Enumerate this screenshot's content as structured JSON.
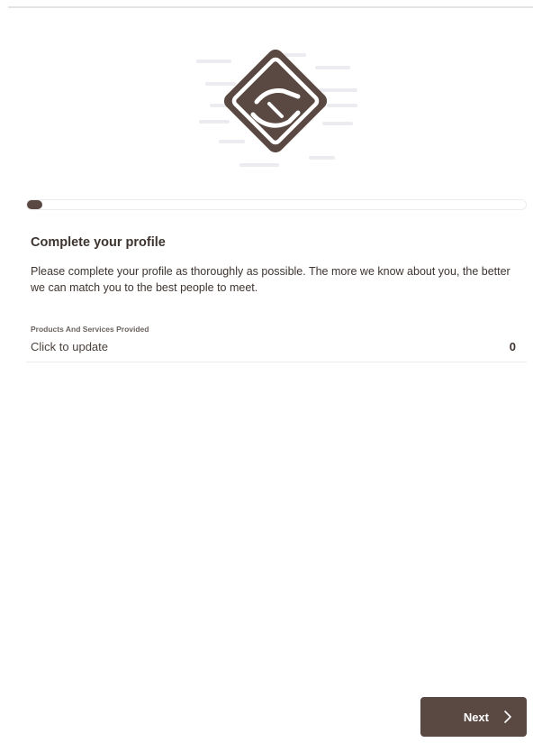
{
  "onboarding": {
    "progress_fraction": 0.03,
    "heading": "Complete your profile",
    "description": "Please complete your profile as thoroughly as possible. The more we know about you, the better we can match you to the best people to meet.",
    "field": {
      "label": "Products And Services Provided",
      "value": "Click to update",
      "count": "0"
    },
    "next_label": "Next",
    "hero_icon": "handshake-icon",
    "next_icon": "chevron-right-icon"
  },
  "colors": {
    "accent": "#5a4943",
    "text": "#3d3430",
    "divider": "#ececec",
    "decor_lines": "#ecebf0"
  }
}
